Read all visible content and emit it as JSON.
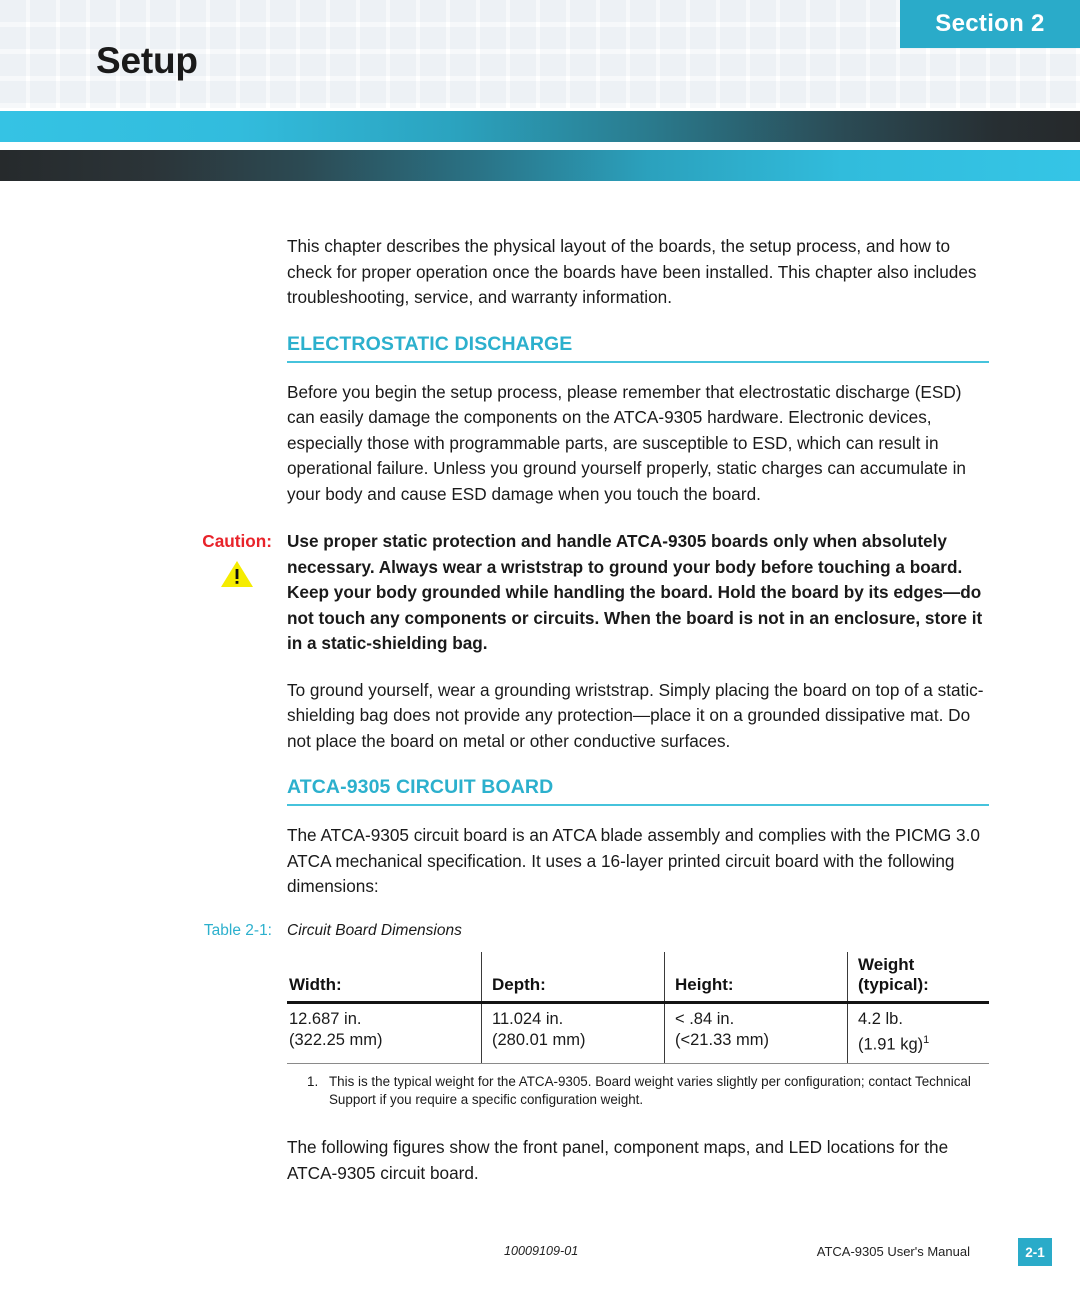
{
  "header": {
    "section_badge": "Section 2",
    "chapter_title": "Setup"
  },
  "intro": {
    "paragraph": "This chapter describes the physical layout of the boards, the setup process, and how to check for proper operation once the boards have been installed. This chapter also includes troubleshooting, service, and warranty information."
  },
  "esd_section": {
    "heading": "ELECTROSTATIC DISCHARGE",
    "paragraph": "Before you begin the setup process, please remember that electrostatic discharge (ESD) can easily damage the components on the ATCA-9305 hardware. Electronic devices, especially those with programmable parts, are susceptible to ESD, which can result in operational failure. Unless you ground yourself properly, static charges can accumulate in your body and cause ESD damage when you touch the board.",
    "caution_label": "Caution:",
    "caution_icon": "warning-triangle-icon",
    "caution_text": "Use proper static protection and handle ATCA-9305 boards only when absolutely necessary. Always wear a wriststrap to ground your body before touching a board. Keep your body grounded while handling the board. Hold the board by its edges—do not touch any components or circuits. When the board is not in an enclosure, store it in a static-shielding bag.",
    "grounding_paragraph": "To ground yourself, wear a grounding wriststrap. Simply placing the board on top of a static-shielding bag does not provide any protection—place it on a grounded dissipative mat. Do not place the board on metal or other conductive surfaces."
  },
  "board_section": {
    "heading": "ATCA-9305 CIRCUIT BOARD",
    "paragraph": "The ATCA-9305 circuit board is an ATCA blade assembly and complies with the PICMG 3.0 ATCA mechanical specification. It uses a 16-layer printed circuit board with the following dimensions:",
    "table_caption_number": "Table 2-1:",
    "table_caption_title": "Circuit Board Dimensions",
    "table": {
      "headers": [
        "Width:",
        "Depth:",
        "Height:",
        "Weight (typical):"
      ],
      "rows": [
        {
          "imperial": [
            "12.687 in.",
            "11.024 in.",
            "< .84 in.",
            "4.2 lb."
          ],
          "metric": [
            "(322.25 mm)",
            "(280.01 mm)",
            "(<21.33 mm)",
            "(1.91 kg)"
          ],
          "metric_superscript": [
            "",
            "",
            "",
            "1"
          ]
        }
      ]
    },
    "footnote_number": "1.",
    "footnote_text": "This is the typical weight for the ATCA-9305. Board weight varies slightly per configuration; contact Technical Support if you require a specific configuration weight.",
    "closing_paragraph": "The following figures show the front panel, component maps, and LED locations for the ATCA-9305 circuit board."
  },
  "footer": {
    "doc_id": "10009109-01",
    "manual_title": "ATCA-9305 User's Manual",
    "page_number": "2-1"
  },
  "colors": {
    "accent_teal": "#2aabc9",
    "heading_teal": "#2cb0cd",
    "caution_red": "#e8232a",
    "warning_yellow": "#f5ec00"
  }
}
